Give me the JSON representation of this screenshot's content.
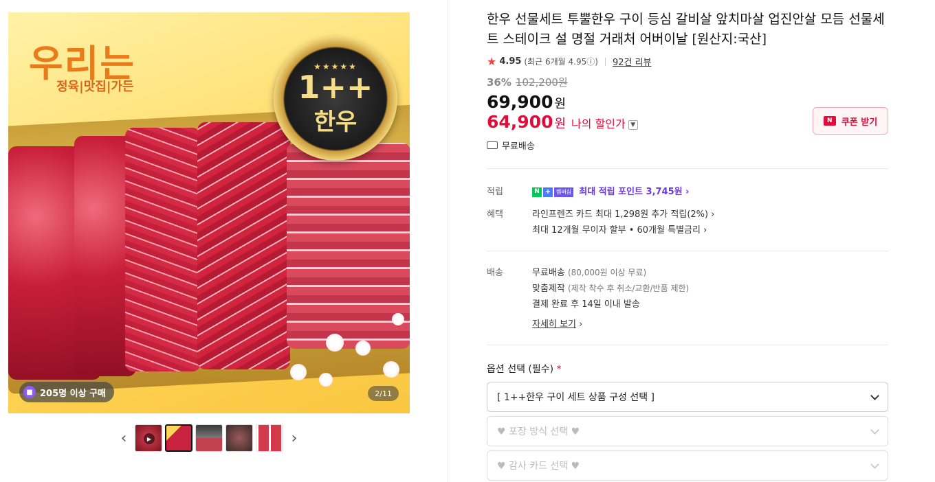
{
  "gallery": {
    "logo_main": "우리는",
    "logo_sub": "정육|맛집|가든",
    "badge_stars": "★★★★★",
    "badge_grade": "1++",
    "badge_kind": "한우",
    "buyers_label": "205명 이상 구매",
    "counter": "2/11",
    "prev_arrow": "‹",
    "next_arrow": "›"
  },
  "product": {
    "title": "한우 선물세트 투뿔한우 구이 등심 갈비살 앞치마살 업진안살 모듬 선물세트 스테이크 설 명절 거래처 어버이날 [원산지:국산]",
    "rating": "4.95",
    "rating_recent": "(최근 6개월 4.95ⓘ)",
    "reviews": "92건 리뷰",
    "discount_rate": "36%",
    "original_price": "102,200원",
    "price": "69,900",
    "price_unit": "원",
    "my_price": "64,900",
    "my_price_unit": "원",
    "my_price_label": "나의 할인가",
    "coupon_label": "쿠폰 받기",
    "shipping_short": "무료배송"
  },
  "benefits": {
    "points_key": "적립",
    "npay_n": "N",
    "npay_plus": "+",
    "npay_member": "멤버십",
    "points_text": "최대 적립 포인트 3,745원 ›",
    "benefit_key": "혜택",
    "benefit_1": "라인프렌즈 카드 최대 1,298원 추가 적립(2%) ›",
    "benefit_2": "최대 12개월 무이자 할부 • 60개월 특별금리 ›"
  },
  "delivery": {
    "key": "배송",
    "line1_main": "무료배송",
    "line1_note": "(80,000원 이상 무료)",
    "line2_main": "맞춤제작",
    "line2_note": "(제작 착수 후 취소/교환/반품 제한)",
    "line3": "결제 완료 후 14일 이내 발송",
    "detail_link": "자세히 보기",
    "detail_chev": "›"
  },
  "options": {
    "title": "옵션 선택 (필수)",
    "required_mark": "*",
    "select1": "[ 1++한우 구이 세트 상품 구성 선택 ]",
    "select2": "♥ 포장 방식 선택 ♥",
    "select3": "♥ 감사 카드 선택 ♥"
  },
  "colors": {
    "accent_red": "#e30b3a",
    "points_purple": "#6b39e8",
    "npay_green": "#03c75a"
  }
}
